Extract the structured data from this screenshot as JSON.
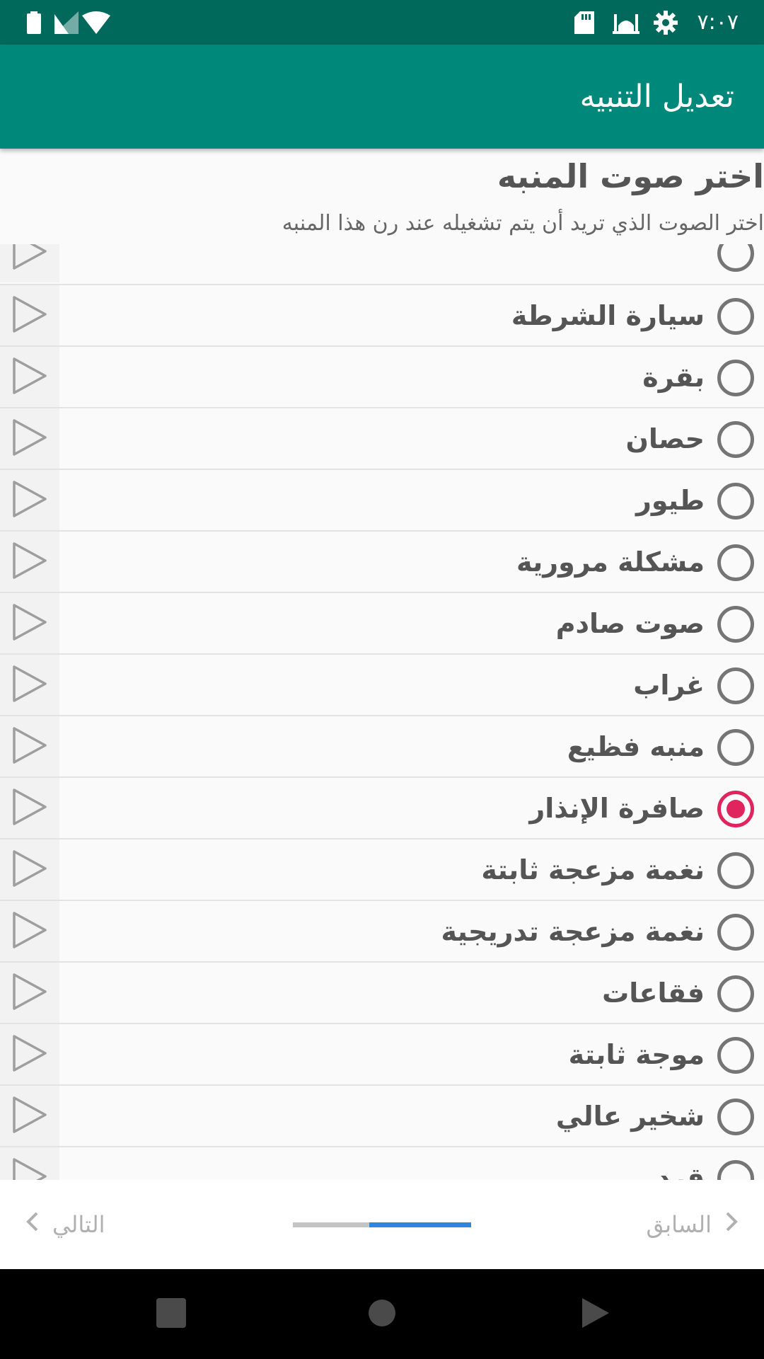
{
  "status_bar": {
    "time": "٧:٠٧",
    "icons": [
      "battery-icon",
      "signal-icon",
      "wifi-icon",
      "sd-card-icon",
      "mosque-icon",
      "settings-icon"
    ]
  },
  "app_bar": {
    "title": "تعديل التنبيه"
  },
  "header": {
    "title": "اختر صوت المنبه",
    "subtitle": "اختر الصوت الذي تريد أن يتم تشغيله عند رن هذا المنبه"
  },
  "sounds": [
    {
      "label": "",
      "checked": false
    },
    {
      "label": "سيارة الشرطة",
      "checked": false
    },
    {
      "label": "بقرة",
      "checked": false
    },
    {
      "label": "حصان",
      "checked": false
    },
    {
      "label": "طيور",
      "checked": false
    },
    {
      "label": "مشكلة مرورية",
      "checked": false
    },
    {
      "label": "صوت صادم",
      "checked": false
    },
    {
      "label": "غراب",
      "checked": false
    },
    {
      "label": "منبه فظيع",
      "checked": false
    },
    {
      "label": "صافرة الإنذار",
      "checked": true
    },
    {
      "label": "نغمة مزعجة ثابتة",
      "checked": false
    },
    {
      "label": "نغمة مزعجة تدريجية",
      "checked": false
    },
    {
      "label": "فقاعات",
      "checked": false
    },
    {
      "label": "موجة ثابتة",
      "checked": false
    },
    {
      "label": "شخير عالي",
      "checked": false
    },
    {
      "label": "قرد",
      "checked": false
    }
  ],
  "wizard_nav": {
    "next_label": "التالي",
    "prev_label": "السابق",
    "progress": {
      "start": 0.43,
      "end": 1.0
    }
  },
  "colors": {
    "status_bar": "#00695c",
    "app_bar": "#00897b",
    "radio_checked": "#e0245e",
    "progress": "#2f86de"
  }
}
